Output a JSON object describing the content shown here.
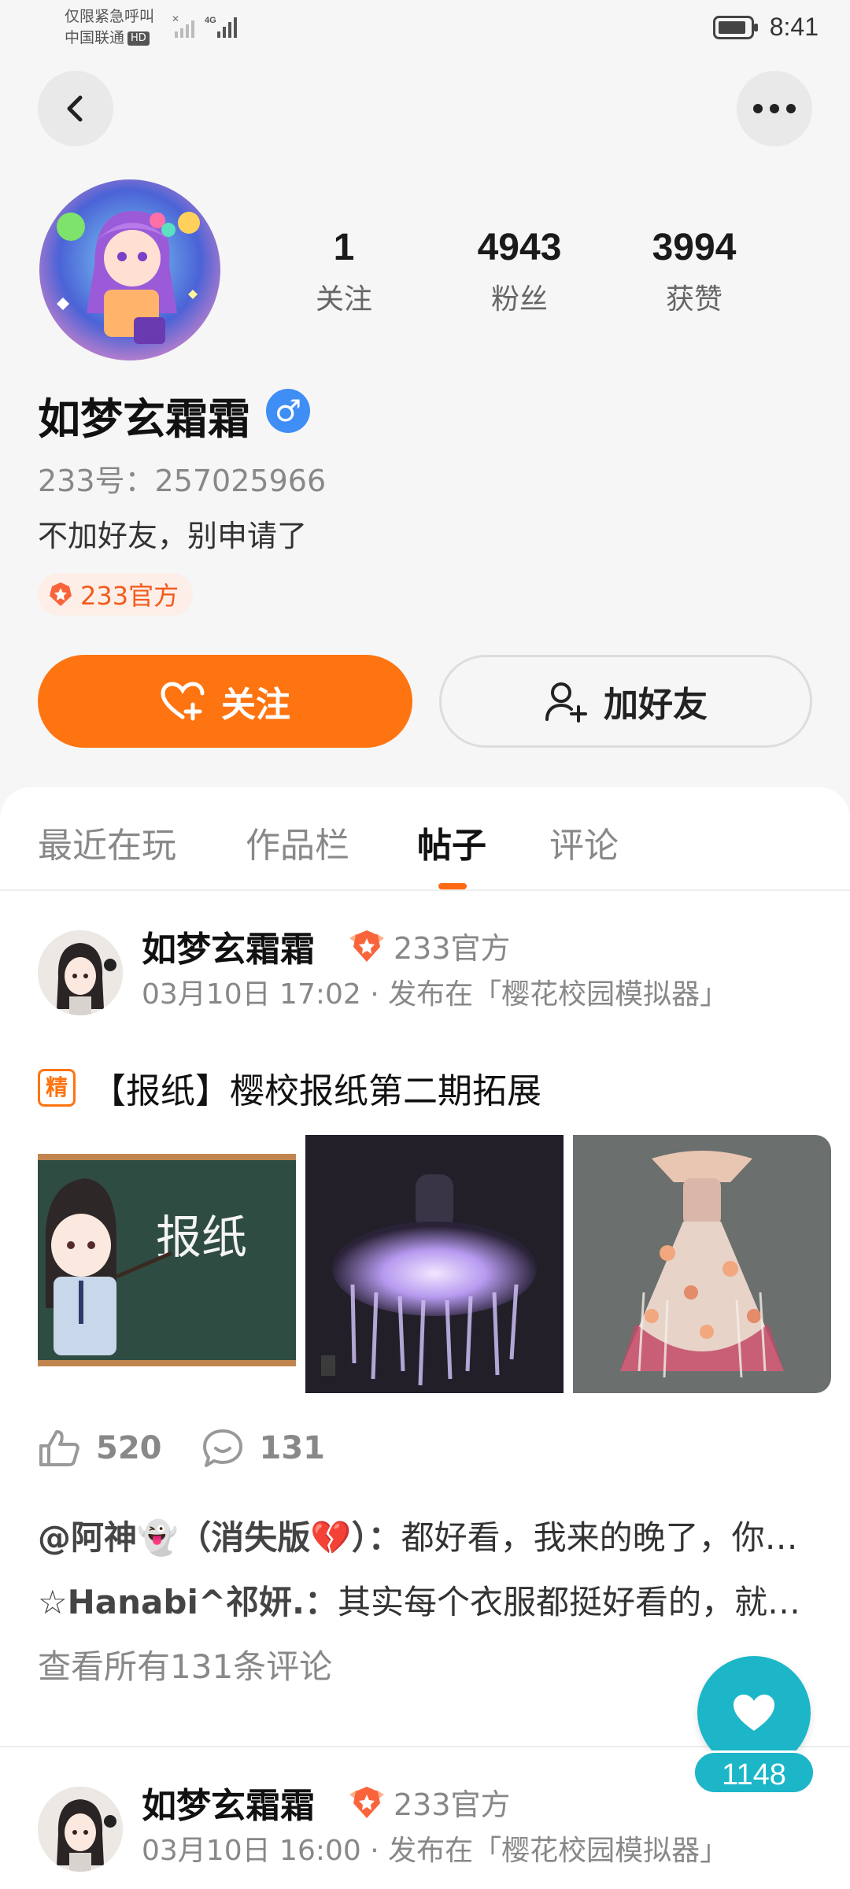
{
  "status_bar": {
    "line1": "仅限紧急呼叫",
    "line2": "中国联通",
    "hd": "HD",
    "network": "4G",
    "time": "8:41"
  },
  "profile": {
    "nickname": "如梦玄霜霜",
    "gender_symbol": "♂",
    "uid": "233号：257025966",
    "bio": "不加好友，别申请了",
    "official_tag": "233官方",
    "stats": [
      {
        "value": "1",
        "label": "关注"
      },
      {
        "value": "4943",
        "label": "粉丝"
      },
      {
        "value": "3994",
        "label": "获赞"
      }
    ],
    "follow_label": "关注",
    "add_friend_label": "加好友"
  },
  "tabs": [
    {
      "label": "最近在玩",
      "active": false
    },
    {
      "label": "作品栏",
      "active": false
    },
    {
      "label": "帖子",
      "active": true
    },
    {
      "label": "评论",
      "active": false
    }
  ],
  "posts": [
    {
      "author": "如梦玄霜霜",
      "official": "233官方",
      "meta": "03月10日 17:02 · 发布在「樱花校园模拟器」",
      "badge": "精",
      "title": "【报纸】樱校报纸第二期拓展",
      "images": [
        "newspaper-chalkboard-image",
        "glowing-jellyfish-dress-image",
        "floral-jellyfish-gown-image"
      ],
      "image_text": "报纸",
      "likes": "520",
      "comments": "131",
      "comment_previews": [
        {
          "user": "@阿神👻（消失版💔）：",
          "text": "都好看，我来的晚了，你们不要杀我😅"
        },
        {
          "user": "☆Hanabi^祁妍.：",
          "text": "其实每个衣服都挺好看的，就是没有男生的"
        }
      ],
      "view_all": "查看所有131条评论"
    },
    {
      "author": "如梦玄霜霜",
      "official": "233官方",
      "meta": "03月10日 16:00 · 发布在「樱花校园模拟器」"
    }
  ],
  "fab": {
    "count": "1148"
  },
  "colors": {
    "accent_orange": "#fe7411",
    "teal": "#1cb6c8",
    "gender_blue": "#3f8ef5"
  }
}
